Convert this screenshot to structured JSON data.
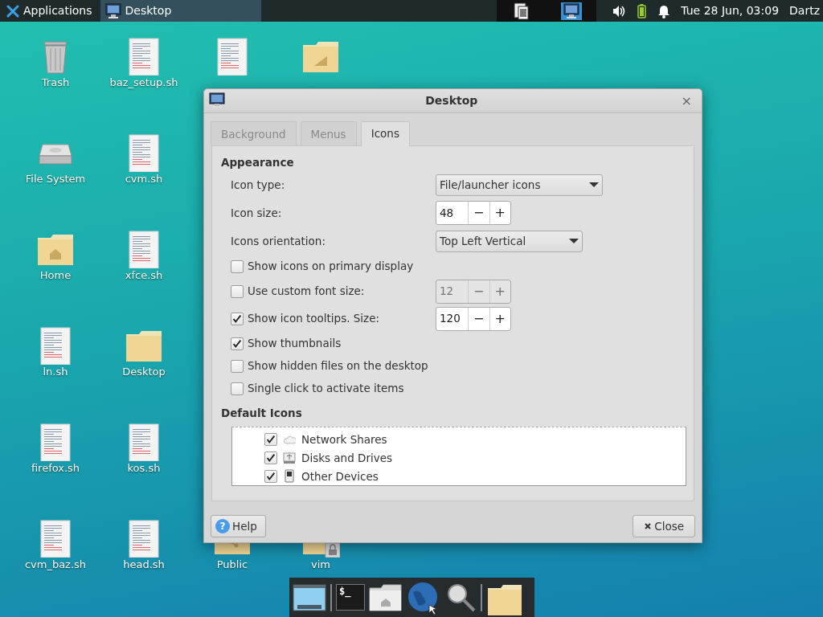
{
  "panel": {
    "apps_label": "Applications",
    "task": {
      "label": "Desktop",
      "selected": true
    },
    "workspaces": [
      {
        "selected": false
      },
      {
        "selected": true
      }
    ],
    "clock": "Tue 28 Jun, 03:09",
    "user": "Dartz"
  },
  "desktop_icons": [
    {
      "kind": "trash",
      "label": "Trash"
    },
    {
      "kind": "drive",
      "label": "File System"
    },
    {
      "kind": "home_folder",
      "label": "Home"
    },
    {
      "kind": "file",
      "label": "ln.sh"
    },
    {
      "kind": "file",
      "label": "firefox.sh"
    },
    {
      "kind": "file",
      "label": "cvm_baz.sh"
    },
    {
      "kind": "file",
      "label": "baz_setup.sh"
    },
    {
      "kind": "file",
      "label": "cvm.sh"
    },
    {
      "kind": "file",
      "label": "xfce.sh"
    },
    {
      "kind": "folder",
      "label": "Desktop"
    },
    {
      "kind": "file",
      "label": "kos.sh"
    },
    {
      "kind": "file",
      "label": "head.sh"
    },
    {
      "kind": "file"
    },
    {
      "kind": "shared_folder",
      "label": "Public"
    },
    {
      "kind": "template_folder"
    },
    {
      "kind": "locked_folder",
      "label": "vim"
    }
  ],
  "dialog": {
    "title": "Desktop",
    "tabs": [
      {
        "label": "Background",
        "selected": false
      },
      {
        "label": "Menus",
        "selected": false
      },
      {
        "label": "Icons",
        "selected": true
      }
    ],
    "appearance": {
      "heading": "Appearance",
      "rows": [
        {
          "kind": "select",
          "label": "Icon type:",
          "value": "File/launcher icons"
        },
        {
          "kind": "spin",
          "label": "Icon size:",
          "value": "48",
          "minus": "−",
          "plus": "+"
        },
        {
          "kind": "select",
          "label": "Icons orientation:",
          "value": "Top Left Vertical"
        },
        {
          "kind": "check",
          "label": "Show icons on primary display",
          "checked": false
        },
        {
          "kind": "check_spin",
          "label": "Use custom font size:",
          "checked": false,
          "value": "12",
          "minus": "−",
          "plus": "+",
          "disabled": true
        },
        {
          "kind": "check_spin",
          "label": "Show icon tooltips. Size:",
          "checked": true,
          "value": "120",
          "minus": "−",
          "plus": "+",
          "disabled": false
        },
        {
          "kind": "check",
          "label": "Show thumbnails",
          "checked": true
        },
        {
          "kind": "check",
          "label": "Show hidden files on the desktop",
          "checked": false
        },
        {
          "kind": "check",
          "label": "Single click to activate items",
          "checked": false
        }
      ]
    },
    "default_icons": {
      "heading": "Default Icons",
      "items": [
        {
          "kind": "network",
          "label": "Network Shares",
          "checked": true
        },
        {
          "kind": "disk",
          "label": "Disks and Drives",
          "checked": true
        },
        {
          "kind": "device",
          "label": "Other Devices",
          "checked": true
        }
      ]
    },
    "help_button": "Help",
    "help_glyph": "?",
    "close_button": "Close",
    "close_glyph": "×"
  },
  "dock": [
    {
      "kind": "windows"
    },
    {
      "kind": "separator"
    },
    {
      "kind": "terminal",
      "glyph": "$_"
    },
    {
      "kind": "home"
    },
    {
      "kind": "globe"
    },
    {
      "kind": "search"
    },
    {
      "kind": "separator"
    },
    {
      "kind": "folder"
    }
  ]
}
